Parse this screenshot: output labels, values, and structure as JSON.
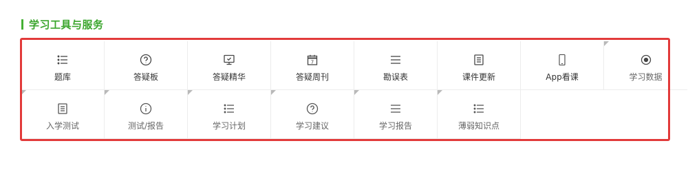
{
  "section": {
    "title": "学习工具与服务"
  },
  "colors": {
    "accent": "#45b035",
    "highlight": "#e23a3a",
    "divider": "#ececec"
  },
  "tools_row1": [
    {
      "label": "题库",
      "icon": "list-icon"
    },
    {
      "label": "答疑板",
      "icon": "question-circle-icon"
    },
    {
      "label": "答疑精华",
      "icon": "monitor-icon"
    },
    {
      "label": "答疑周刊",
      "icon": "calendar-icon"
    },
    {
      "label": "勘误表",
      "icon": "menu-lines-icon"
    },
    {
      "label": "课件更新",
      "icon": "document-icon"
    },
    {
      "label": "App看课",
      "icon": "phone-icon"
    },
    {
      "label": "学习数据",
      "icon": "target-icon"
    }
  ],
  "tools_row2": [
    {
      "label": "入学测试",
      "icon": "document-icon"
    },
    {
      "label": "测试/报告",
      "icon": "info-circle-icon"
    },
    {
      "label": "学习计划",
      "icon": "list-icon"
    },
    {
      "label": "学习建议",
      "icon": "question-circle-icon"
    },
    {
      "label": "学习报告",
      "icon": "menu-lines-icon"
    },
    {
      "label": "薄弱知识点",
      "icon": "list-icon"
    }
  ]
}
